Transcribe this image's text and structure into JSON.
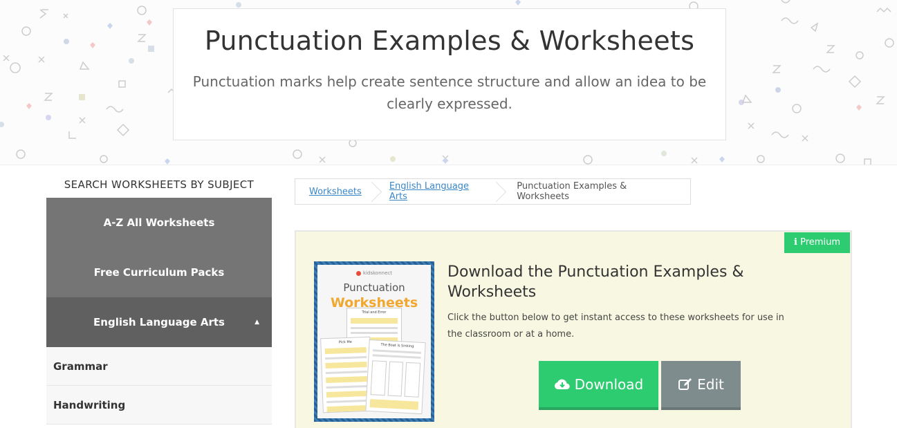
{
  "hero": {
    "title": "Punctuation Examples & Worksheets",
    "description": "Punctuation marks help create sentence structure and allow an idea to be clearly expressed."
  },
  "sidebar": {
    "heading": "SEARCH WORKSHEETS BY SUBJECT",
    "buttons": [
      {
        "label": "A-Z All Worksheets"
      },
      {
        "label": "Free Curriculum Packs"
      },
      {
        "label": "English Language Arts",
        "expanded": true
      }
    ],
    "items": [
      {
        "label": "Grammar"
      },
      {
        "label": "Handwriting"
      }
    ]
  },
  "breadcrumb": {
    "items": [
      {
        "label": "Worksheets",
        "link": true
      },
      {
        "label": "English Language Arts",
        "link": true
      },
      {
        "label": "Punctuation Examples & Worksheets",
        "link": false
      }
    ]
  },
  "premium": {
    "badge_label": "Premium",
    "title": "Download the Punctuation Examples & Worksheets",
    "description": "Click the button below to get instant access to these worksheets for use in the classroom or at a home.",
    "thumbnail": {
      "brand": "kidskonnect",
      "title_line1": "Punctuation",
      "title_line2": "Worksheets",
      "sheet1": "Trial and Error",
      "sheet2": "Pick Me",
      "sheet3": "The Boat is Sinking"
    },
    "download_label": "Download",
    "edit_label": "Edit"
  },
  "colors": {
    "green": "#2ecc71",
    "gray_button": "#7f8c8d",
    "sidebar_button": "#757575",
    "sidebar_active": "#606060",
    "premium_bg": "#f8f8e2",
    "link": "#3a87c8"
  },
  "icons": [
    "info-icon",
    "cloud-download-icon",
    "edit-icon",
    "caret-up-icon"
  ]
}
